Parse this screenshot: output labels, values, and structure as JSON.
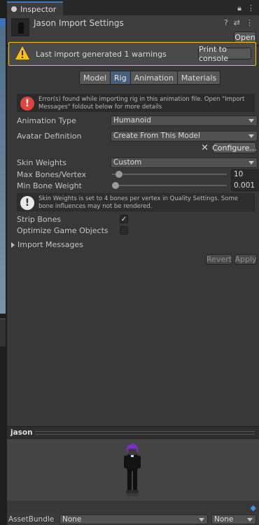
{
  "window": {
    "tab_label": "Inspector",
    "tab_icon": "info-icon",
    "header_icons": [
      "lock-icon",
      "kebab-menu-icon"
    ]
  },
  "header": {
    "title": "Jason Import Settings",
    "open_label": "Open",
    "icons": [
      "help-icon",
      "preset-icon",
      "kebab-menu-icon"
    ]
  },
  "warning": {
    "message": "Last import generated 1 warnings",
    "print_label": "Print to console",
    "color": "#ffbf00"
  },
  "tabs": [
    {
      "label": "Model",
      "active": false
    },
    {
      "label": "Rig",
      "active": true
    },
    {
      "label": "Animation",
      "active": false
    },
    {
      "label": "Materials",
      "active": false
    }
  ],
  "error": {
    "message": "Error(s) found while importing rig in this animation file. Open \"Import Messages\" foldout below for more details",
    "color": "#e0453d"
  },
  "fields": {
    "animation_type": {
      "label": "Animation Type",
      "value": "Humanoid"
    },
    "avatar_definition": {
      "label": "Avatar Definition",
      "value": "Create From This Model"
    },
    "configure_label": "Configure...",
    "skin_weights": {
      "label": "Skin Weights",
      "value": "Custom"
    },
    "max_bones": {
      "label": "Max Bones/Vertex",
      "value": "10",
      "fraction": 0.03
    },
    "min_bone_weight": {
      "label": "Min Bone Weight",
      "value": "0.001",
      "fraction": 0.0
    },
    "strip_bones": {
      "label": "Strip Bones",
      "checked": true
    },
    "optimize_game_objects": {
      "label": "Optimize Game Objects",
      "checked": false
    }
  },
  "info": {
    "message": "Skin Weights is set to 4 bones per vertex in Quality Settings. Some bone influences may not be rendered."
  },
  "import_messages_label": "Import Messages",
  "actions": {
    "revert": "Revert",
    "apply": "Apply"
  },
  "preview": {
    "name": "jason"
  },
  "footer": {
    "label": "AssetBundle",
    "bundle": "None",
    "variant": "None"
  }
}
